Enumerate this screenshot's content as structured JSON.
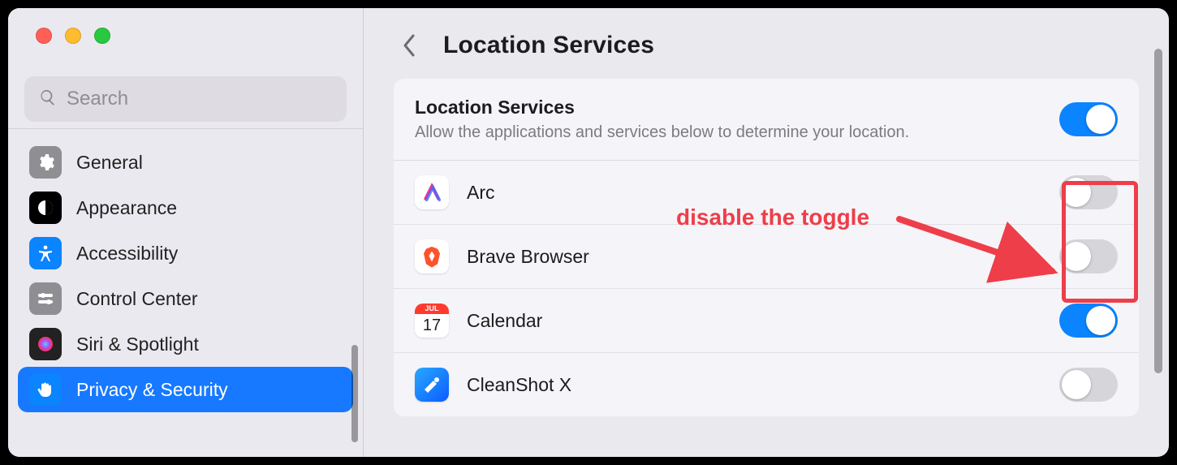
{
  "window": {
    "search_placeholder": "Search"
  },
  "sidebar": {
    "items": [
      {
        "label": "General",
        "icon": "gear",
        "bg": "#8e8e93"
      },
      {
        "label": "Appearance",
        "icon": "appearance",
        "bg": "#000000"
      },
      {
        "label": "Accessibility",
        "icon": "accessibility",
        "bg": "#0a84ff"
      },
      {
        "label": "Control Center",
        "icon": "sliders",
        "bg": "#8e8e93"
      },
      {
        "label": "Siri & Spotlight",
        "icon": "siri",
        "bg": "#222222"
      },
      {
        "label": "Privacy & Security",
        "icon": "hand",
        "bg": "#0a84ff",
        "selected": true
      }
    ]
  },
  "main": {
    "title": "Location Services",
    "master": {
      "title": "Location Services",
      "subtitle": "Allow the applications and services below to determine your location.",
      "enabled": true
    },
    "apps": [
      {
        "name": "Arc",
        "icon": "arc",
        "enabled": false
      },
      {
        "name": "Brave Browser",
        "icon": "brave",
        "enabled": false
      },
      {
        "name": "Calendar",
        "icon": "calendar",
        "enabled": true,
        "cal_month": "JUL",
        "cal_day": "17"
      },
      {
        "name": "CleanShot X",
        "icon": "cleanshot",
        "enabled": false
      }
    ]
  },
  "annotation": {
    "text": "disable the toggle"
  },
  "colors": {
    "accent": "#0a84ff",
    "annotation": "#ee3e4a"
  }
}
